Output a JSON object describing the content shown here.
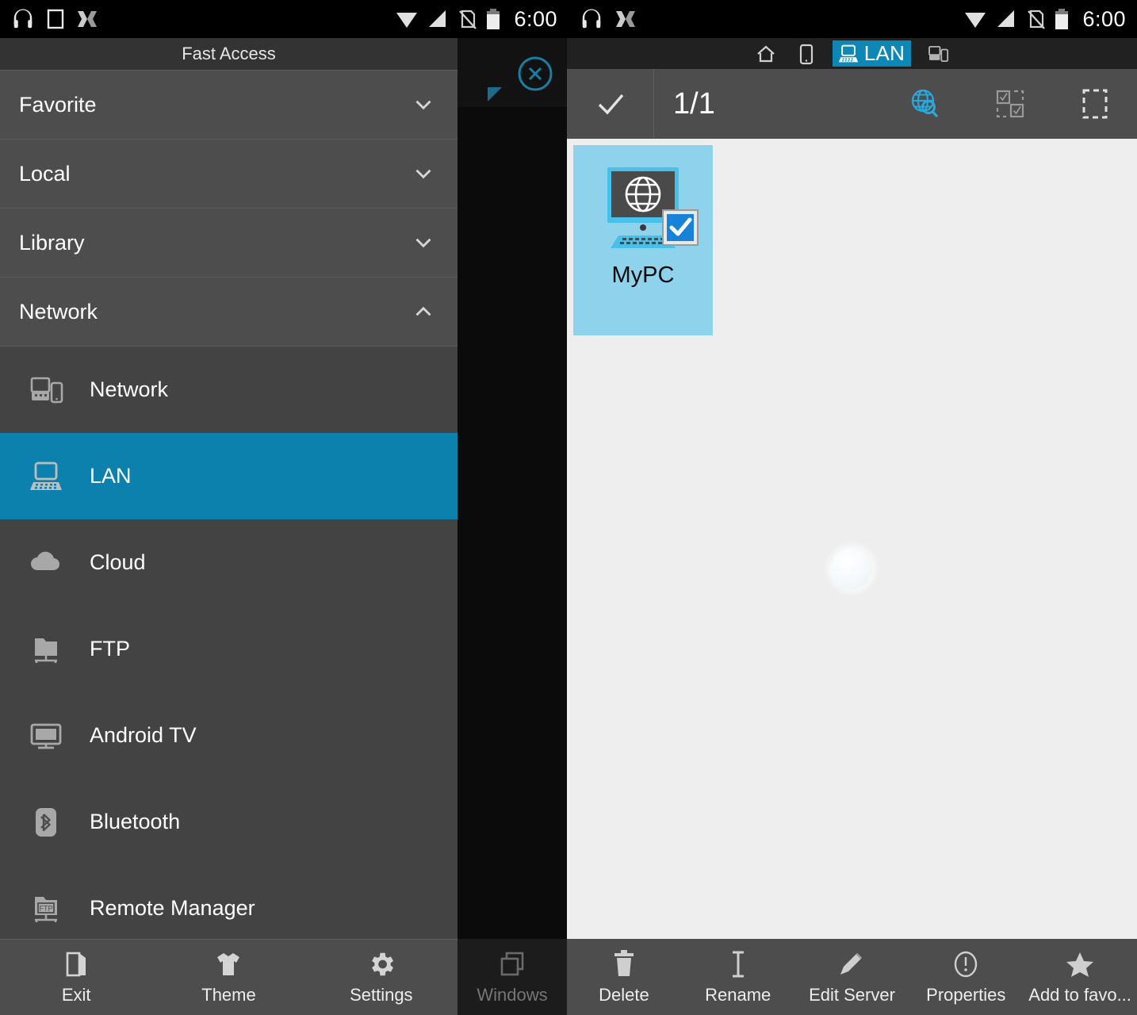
{
  "status_bar": {
    "time": "6:00",
    "left_icons": [
      "headphones-icon",
      "square-icon",
      "mx-player-icon"
    ],
    "right_icons": [
      "wifi-icon",
      "signal-icon",
      "no-sim-icon",
      "battery-icon"
    ],
    "second_left_icons": [
      "headphones-icon",
      "mx-player-icon"
    ]
  },
  "drawer": {
    "title": "Fast Access",
    "groups": [
      {
        "label": "Favorite",
        "expanded": false,
        "chevron": "chevron-down-icon"
      },
      {
        "label": "Local",
        "expanded": false,
        "chevron": "chevron-down-icon"
      },
      {
        "label": "Library",
        "expanded": false,
        "chevron": "chevron-down-icon"
      },
      {
        "label": "Network",
        "expanded": true,
        "chevron": "chevron-up-icon"
      }
    ],
    "children": [
      {
        "label": "Network",
        "icon": "network-devices-icon",
        "selected": false
      },
      {
        "label": "LAN",
        "icon": "lan-computer-icon",
        "selected": true
      },
      {
        "label": "Cloud",
        "icon": "cloud-icon",
        "selected": false
      },
      {
        "label": "FTP",
        "icon": "ftp-folder-icon",
        "selected": false
      },
      {
        "label": "Android TV",
        "icon": "tv-icon",
        "selected": false
      },
      {
        "label": "Bluetooth",
        "icon": "bluetooth-icon",
        "selected": false
      },
      {
        "label": "Remote Manager",
        "icon": "remote-manager-icon",
        "selected": false
      }
    ],
    "selected_color": "#0d81ad",
    "bottom_bar": [
      {
        "label": "Exit",
        "icon": "exit-door-icon"
      },
      {
        "label": "Theme",
        "icon": "tshirt-icon"
      },
      {
        "label": "Settings",
        "icon": "gear-icon"
      }
    ]
  },
  "scrim": {
    "close_icon": "close-circle-icon",
    "handle_icon": "resize-triangle-icon",
    "windows_button": {
      "label": "Windows",
      "icon": "windows-stack-icon",
      "enabled": false
    }
  },
  "right_pane": {
    "tabs": [
      {
        "icon": "home-icon",
        "label": "",
        "active": false
      },
      {
        "icon": "phone-icon",
        "label": "",
        "active": false
      },
      {
        "icon": "lan-computer-icon",
        "label": "LAN",
        "active": true
      },
      {
        "icon": "network-devices-icon",
        "label": "",
        "active": false
      }
    ],
    "tab_active_color": "#0d87b5",
    "toolbar": {
      "confirm_icon": "check-icon",
      "count": "1/1",
      "buttons": [
        {
          "icon": "globe-search-icon",
          "name": "scan-network-button"
        },
        {
          "icon": "select-multiple-icon",
          "name": "select-multiple-button"
        },
        {
          "icon": "select-all-icon",
          "name": "select-all-button"
        }
      ]
    },
    "items": [
      {
        "name": "MyPC",
        "icon": "computer-globe-icon",
        "selected": true,
        "checked": true
      }
    ],
    "selection_color": "#8ed3eb",
    "loading_indicator": "ripple-circle",
    "bottom_bar": [
      {
        "label": "Delete",
        "icon": "trash-icon"
      },
      {
        "label": "Rename",
        "icon": "text-cursor-icon"
      },
      {
        "label": "Edit Server",
        "icon": "pencil-icon"
      },
      {
        "label": "Properties",
        "icon": "info-circle-icon"
      },
      {
        "label": "Add to favo...",
        "icon": "star-icon"
      }
    ]
  }
}
